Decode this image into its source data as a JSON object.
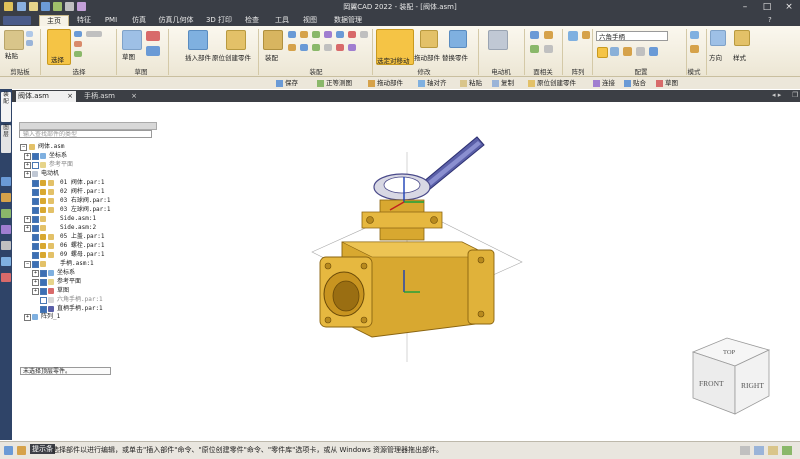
{
  "window": {
    "title": "岡翼CAD 2022 - 装配 - [阀体.asm]"
  },
  "ribbon_tabs": [
    "主页",
    "特征",
    "PMI",
    "仿真",
    "仿真几何体",
    "3D 打印",
    "检查",
    "工具",
    "视图",
    "数据管理"
  ],
  "groups": {
    "clipboard": "剪贴板",
    "select": "选择",
    "sketch": "草图",
    "assemble": "装配",
    "modify": "修改",
    "motor": "电动机",
    "faces": "面相关",
    "pattern": "阵列",
    "config": "配置",
    "mode": "模式"
  },
  "buttons": {
    "paste": "粘贴",
    "select": "选择",
    "sketch": "草图",
    "insert_component": "插入部件",
    "inplace_create": "原位创建零件",
    "assemble": "装配",
    "select_move": "选定对移动",
    "drag_component": "拖动部件",
    "replace_part": "替换零件",
    "direction": "方向",
    "style": "样式"
  },
  "config_dropdown": "六角手柄",
  "command_bar": [
    "保存",
    "正等测图",
    "拖动部件",
    "轴对齐",
    "粘贴",
    "复制",
    "原位创建零件",
    "连接",
    "贴合",
    "草图"
  ],
  "doc_tabs": [
    "阀体.asm",
    "手柄.asm"
  ],
  "vertical_tabs": [
    "装配",
    "图层",
    "库",
    "属性",
    "关系",
    "零件",
    "传感器",
    "部件",
    "族"
  ],
  "search_placeholder": "输入查找部件的类型",
  "tree": [
    {
      "label": "阀体.asm",
      "level": 0
    },
    {
      "label": "坐标系",
      "level": 1
    },
    {
      "label": "参考平面",
      "level": 1
    },
    {
      "label": "电动机",
      "level": 1
    },
    {
      "label": "01 阀体.par:1",
      "level": 1
    },
    {
      "label": "02 阀杆.par:1",
      "level": 1
    },
    {
      "label": "03 右球阀.par:1",
      "level": 1
    },
    {
      "label": "03 左球阀.par:1",
      "level": 1
    },
    {
      "label": "Side.asm:1",
      "level": 1
    },
    {
      "label": "Side.asm:2",
      "level": 1
    },
    {
      "label": "05 上盖.par:1",
      "level": 1
    },
    {
      "label": "06 螺栓.par:1",
      "level": 1
    },
    {
      "label": "09 螺母.par:1",
      "level": 1
    },
    {
      "label": "手柄.asm:1",
      "level": 1
    },
    {
      "label": "坐标系",
      "level": 2
    },
    {
      "label": "参考平面",
      "level": 2
    },
    {
      "label": "草图",
      "level": 2
    },
    {
      "label": "六角手柄.par:1",
      "level": 2
    },
    {
      "label": "直柄手柄.par:1",
      "level": 2
    },
    {
      "label": "阵列_1",
      "level": 1
    }
  ],
  "tooltip": "未选择顶层零件。",
  "viewcube": {
    "top": "TOP",
    "front": "FRONT",
    "right": "RIGHT"
  },
  "status": {
    "label": "提示条",
    "prompt": "选择部件以进行编辑，或单击\"插入部件\"命令、\"原位创建零件\"命令、\"零件库\"选项卡，或从 Windows 资源管理器拖出部件。"
  },
  "colors": {
    "titlebar": "#3a3e46",
    "accent": "#f5c445",
    "part": "#d8a830",
    "tree_blue": "#3c6fb4"
  }
}
